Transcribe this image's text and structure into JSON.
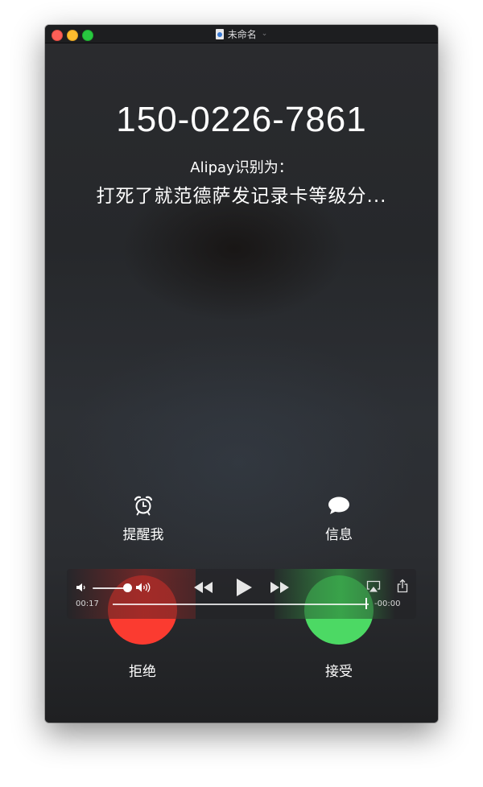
{
  "window": {
    "title": "未命名"
  },
  "call": {
    "phone_number": "150-0226-7861",
    "source_label": "Alipay识别为：",
    "caller_tag": "打死了就范德萨发记录卡等级分..."
  },
  "actions": {
    "remind_label": "提醒我",
    "message_label": "信息",
    "decline_label": "拒绝",
    "accept_label": "接受"
  },
  "player": {
    "current_time": "00:17",
    "remaining_time": "-00:00",
    "volume_level": 0.8,
    "progress": 1.0
  },
  "colors": {
    "decline": "#fb3b30",
    "accept": "#4cd964"
  },
  "icons": {
    "remind": "alarm-clock-icon",
    "message": "speech-bubble-icon",
    "volume_low": "speaker-low-icon",
    "volume_high": "speaker-high-icon",
    "rewind": "rewind-icon",
    "play": "play-icon",
    "forward": "fast-forward-icon",
    "airplay": "airplay-icon",
    "share": "share-icon"
  }
}
